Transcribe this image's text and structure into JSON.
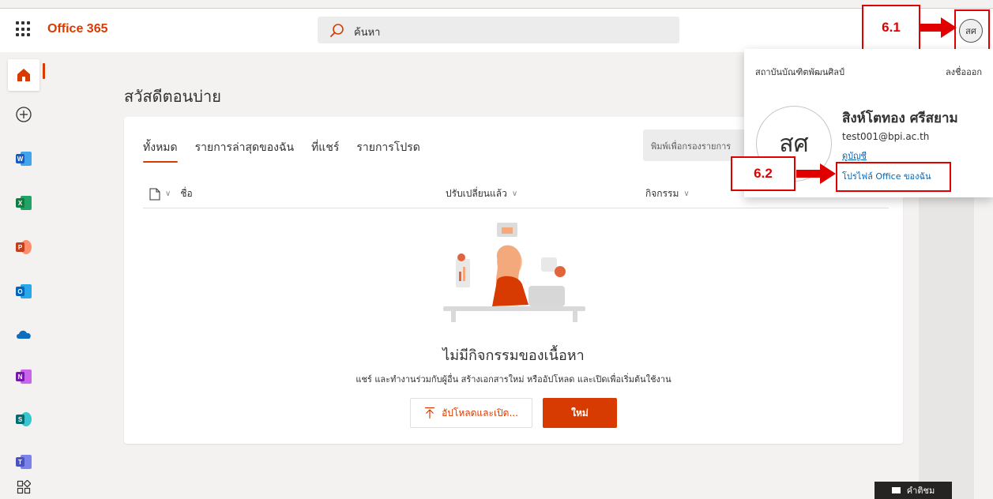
{
  "header": {
    "brand": "Office 365",
    "search_placeholder": "ค้นหา",
    "avatar_initials": "สศ"
  },
  "annotations": {
    "step1": "6.1",
    "step2": "6.2"
  },
  "main": {
    "greeting": "สวัสดีตอนบ่าย",
    "tabs": [
      {
        "label": "ทั้งหมด",
        "active": true
      },
      {
        "label": "รายการล่าสุดของฉัน"
      },
      {
        "label": "ที่แชร์"
      },
      {
        "label": "รายการโปรด"
      }
    ],
    "filter_placeholder": "พิมพ์เพื่อกรองรายการ",
    "columns": {
      "name": "ชื่อ",
      "modified": "ปรับเปลี่ยนแล้ว",
      "activity": "กิจกรรม"
    },
    "empty_title": "ไม่มีกิจกรรมของเนื้อหา",
    "empty_subtitle": "แชร์ และทำงานร่วมกับผู้อื่น สร้างเอกสารใหม่ หรืออัปโหลด และเปิดเพื่อเริ่มต้นใช้งาน",
    "upload_label": "อัปโหลดและเปิด...",
    "new_label": "ใหม่"
  },
  "account_panel": {
    "organization": "สถาบันบัณฑิตพัฒนศิลป์",
    "sign_out": "ลงชื่อออก",
    "initials": "สศ",
    "user_name": "สิงห์โตทอง ศรีสยาม",
    "email": "test001@bpi.ac.th",
    "view_account": "ดูบัญชี",
    "my_profile": "โปรไฟล์ Office ของฉัน"
  },
  "help_button": "คำติชม",
  "colors": {
    "brand": "#d83b01",
    "annotation": "#e00000",
    "link": "#0067b8"
  }
}
